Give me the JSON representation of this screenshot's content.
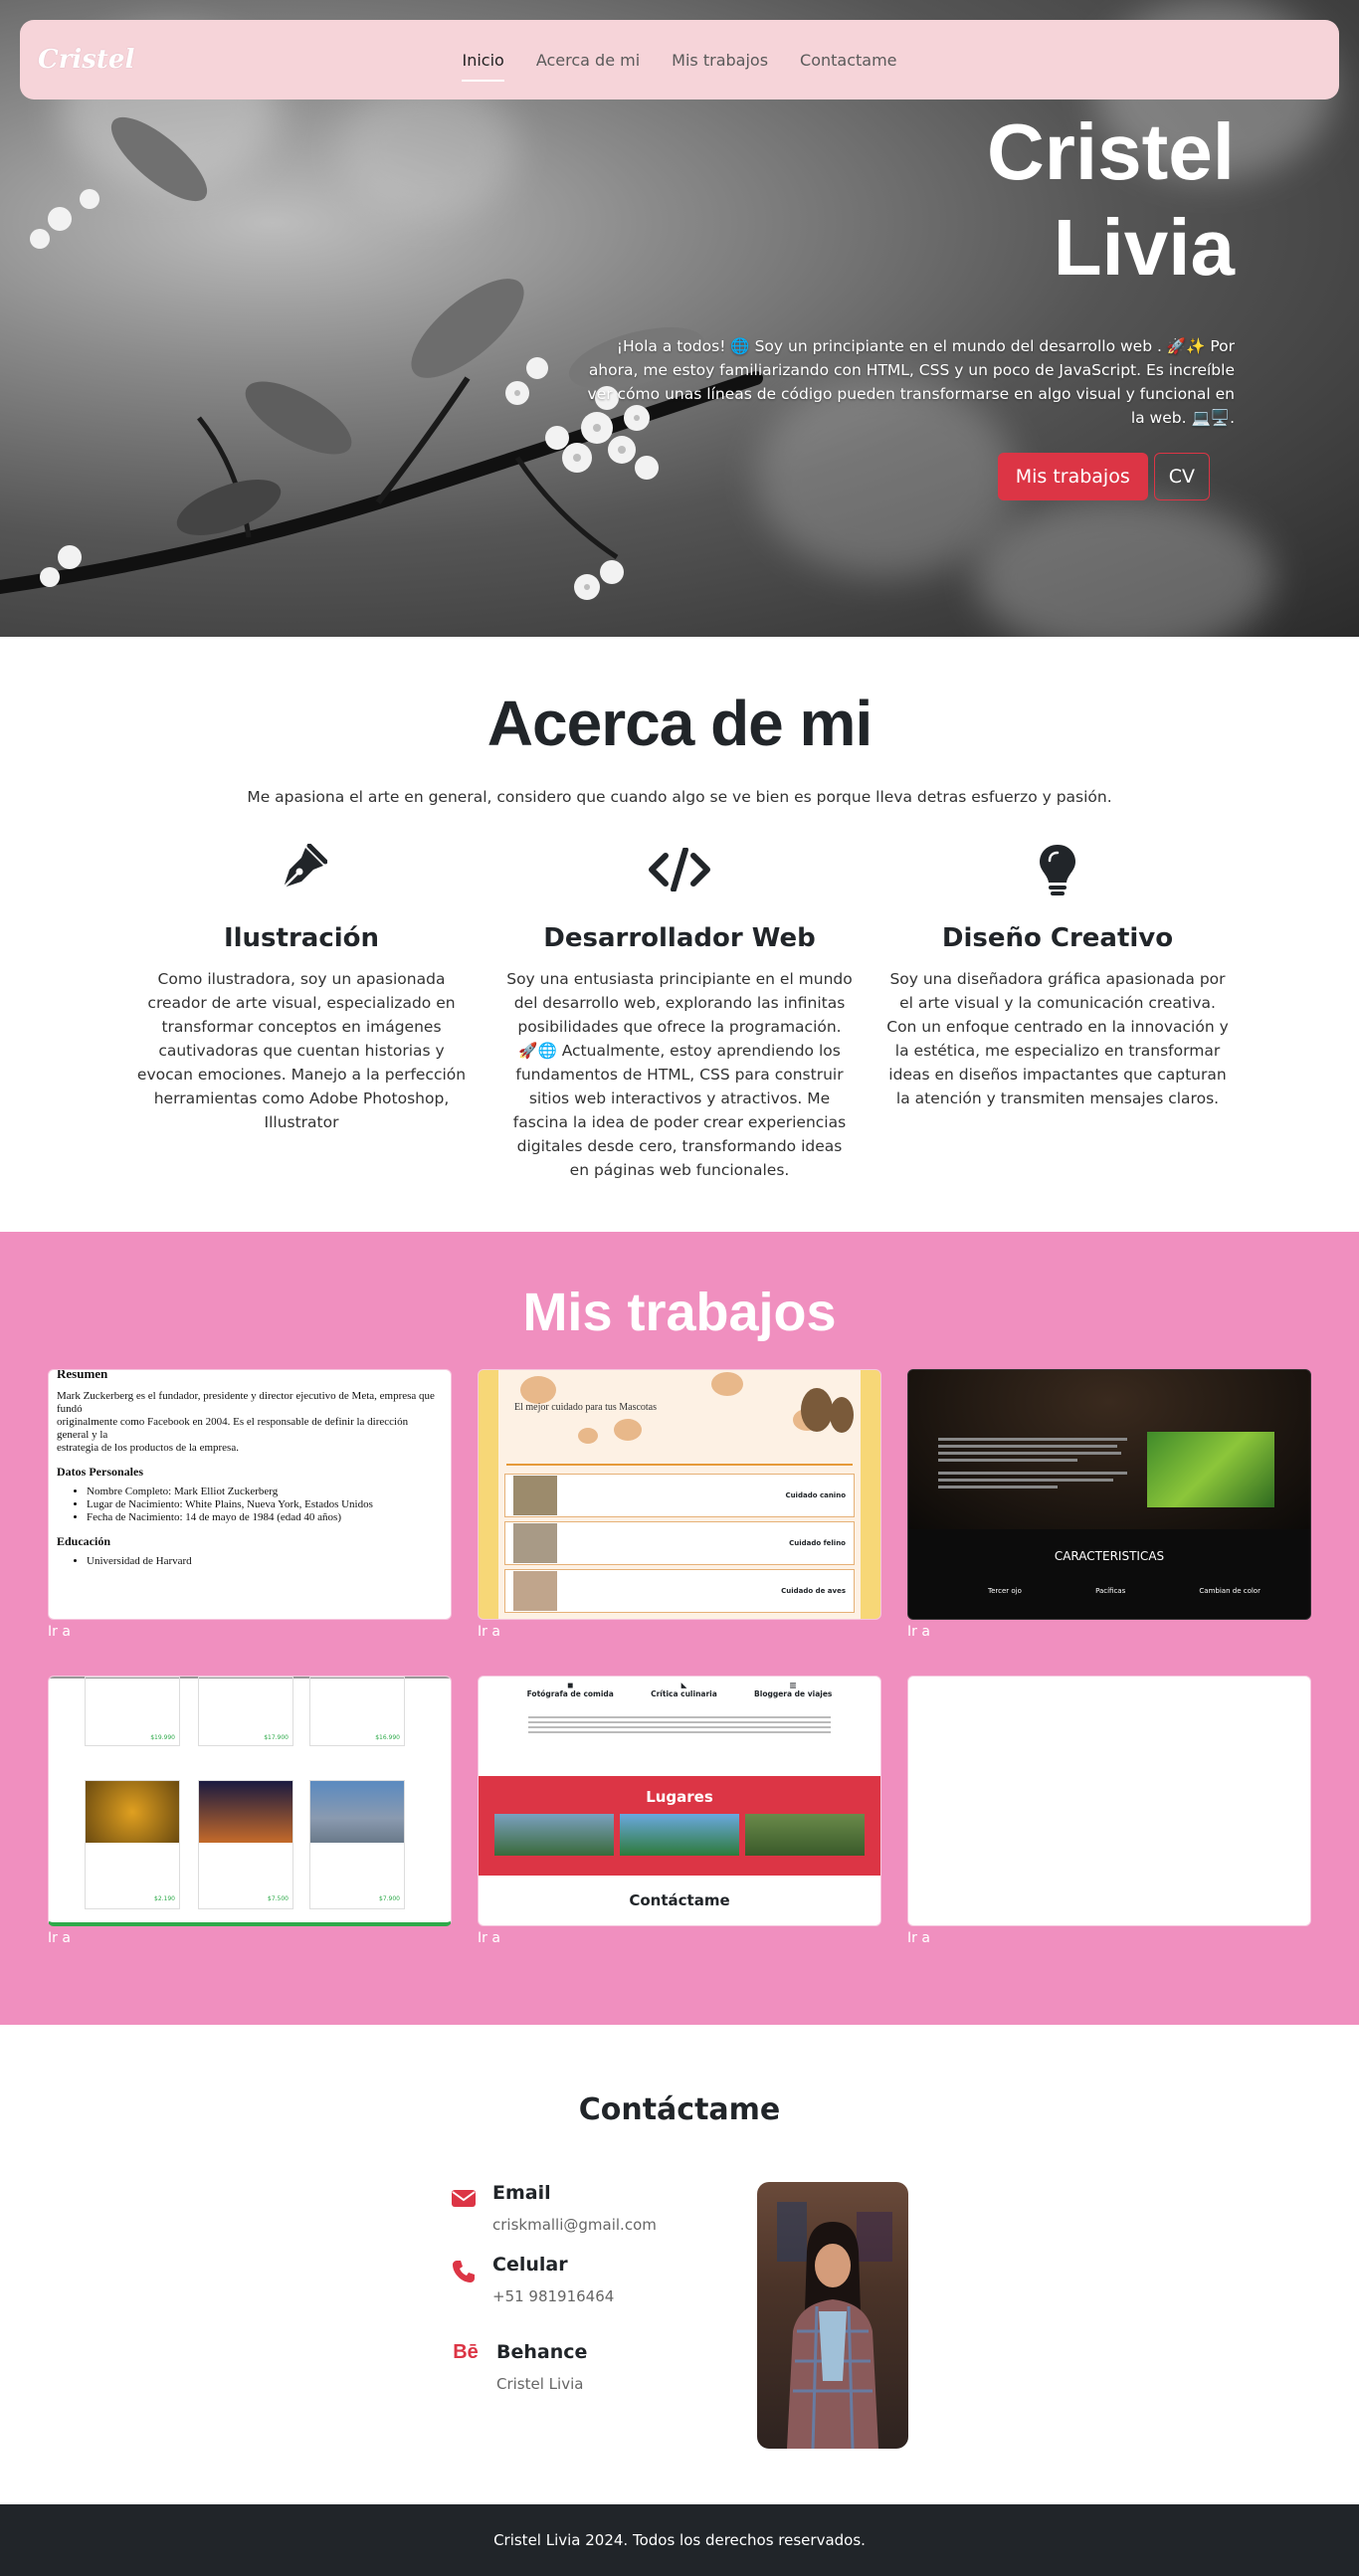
{
  "nav": {
    "brand": "Cristel",
    "links": [
      "Inicio",
      "Acerca de mi",
      "Mis trabajos",
      "Contactame"
    ]
  },
  "hero": {
    "title_line1": "Cristel",
    "title_line2": "Livia",
    "text": "¡Hola a todos! 🌐 Soy un principiante en el mundo del desarrollo web . 🚀✨ Por ahora, me estoy familiarizando con HTML, CSS y un poco de JavaScript. Es increíble ver cómo unas líneas de código pueden transformarse en algo visual y funcional en la web. 💻🖥️.",
    "btn_works": "Mis trabajos",
    "btn_cv": "CV"
  },
  "about": {
    "title": "Acerca de mi",
    "lead": "Me apasiona el arte en general, considero que cuando algo se ve bien es porque lleva detras esfuerzo y pasión.",
    "features": [
      {
        "icon": "pen-nib-icon",
        "title": "Ilustración",
        "text": "Como ilustradora, soy un apasionada creador de arte visual, especializado en transformar conceptos en imágenes cautivadoras que cuentan historias y evocan emociones. Manejo a la perfección herramientas como Adobe Photoshop, Illustrator"
      },
      {
        "icon": "code-icon",
        "title": "Desarrollador Web",
        "text": "Soy una entusiasta principiante en el mundo del desarrollo web, explorando las infinitas posibilidades que ofrece la programación. 🚀🌐 Actualmente, estoy aprendiendo los fundamentos de HTML, CSS para construir sitios web interactivos y atractivos. Me fascina la idea de poder crear experiencias digitales desde cero, transformando ideas en páginas web funcionales."
      },
      {
        "icon": "lightbulb-icon",
        "title": "Diseño Creativo",
        "text": "Soy una diseñadora gráfica apasionada por el arte visual y la comunicación creativa. Con un enfoque centrado en la innovación y la estética, me especializo en transformar ideas en diseños impactantes que capturan la atención y transmiten mensajes claros."
      }
    ]
  },
  "works": {
    "title": "Mis trabajos",
    "link_label": "Ir a",
    "thumb1": {
      "heading": "Resumen",
      "line1": "Mark Zuckerberg es el fundador, presidente y director ejecutivo de Meta, empresa que fundó",
      "line2": "originalmente como Facebook en 2004. Es el responsable de definir la dirección general y la",
      "line3": "estrategia de los productos de la empresa.",
      "sub1": "Datos Personales",
      "items": [
        "Nombre Completo: Mark Elliot Zuckerberg",
        "Lugar de Nacimiento: White Plains, Nueva York, Estados Unidos",
        "Fecha de Nacimiento: 14 de mayo de 1984 (edad 40 años)"
      ],
      "sub2": "Educación",
      "edu": "Universidad de Harvard"
    },
    "thumb2": {
      "title": "El mejor cuidado para tus Mascotas",
      "rows": [
        "Cuidado canino",
        "Cuidado felino",
        "Cuidado de aves"
      ]
    },
    "thumb3": {
      "caption": "CARACTERISTICAS",
      "features": [
        "Tercer ojo",
        "Pacíficas",
        "Cambian de color"
      ]
    },
    "thumb4": {
      "prices": [
        "$19.990",
        "$17.900",
        "$16.990",
        "$2.190",
        "$7.500",
        "$7.900"
      ]
    },
    "thumb5": {
      "cols": [
        "Fotógrafa de comida",
        "Crítica culinaria",
        "Bloggera de viajes"
      ],
      "band": "Lugares",
      "contact": "Contáctame"
    }
  },
  "contact": {
    "title": "Contáctame",
    "email_label": "Email",
    "email": "criskmalli@gmail.com",
    "phone_label": "Celular",
    "phone": "+51 981916464",
    "behance_label": "Behance",
    "behance": "Cristel Livia"
  },
  "footer": {
    "text": "Cristel Livia 2024. Todos los derechos reservados."
  },
  "colors": {
    "accent": "#dc3545",
    "nav_bg": "#f6d4d9",
    "works_bg": "#f08fbf",
    "footer_bg": "#212529"
  }
}
